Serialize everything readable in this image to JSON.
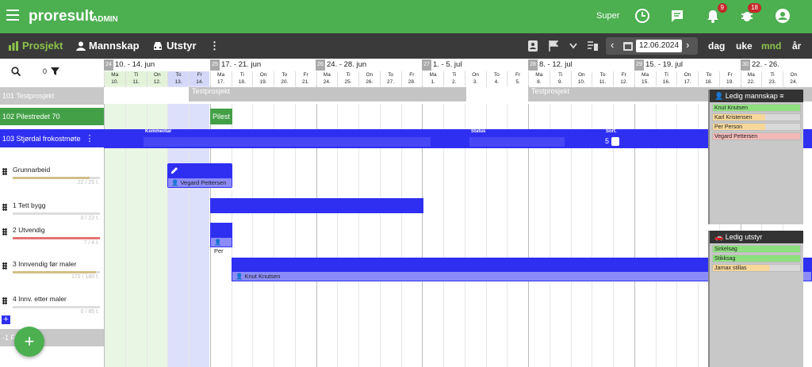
{
  "app": {
    "brand": "proresult",
    "edition": "ADMIN",
    "user": "Super"
  },
  "badges": {
    "notifications": "9",
    "alerts": "18"
  },
  "toolbar": {
    "tab_project": "Prosjekt",
    "tab_manpower": "Mannskap",
    "tab_equipment": "Utstyr",
    "date": "12.06.2024",
    "views": [
      "dag",
      "uke",
      "mnd",
      "år"
    ],
    "active_view": "mnd"
  },
  "filter": {
    "count": "0"
  },
  "weeks": [
    {
      "num": "24",
      "label": "10. - 14. jun"
    },
    {
      "num": "25",
      "label": "17. - 21. jun"
    },
    {
      "num": "26",
      "label": "24. - 28. jun"
    },
    {
      "num": "27",
      "label": "1. - 5. jul"
    },
    {
      "num": "28",
      "label": "8. - 12. jul"
    },
    {
      "num": "29",
      "label": "15. - 19. jul"
    },
    {
      "num": "30",
      "label": "22. - 26."
    }
  ],
  "days": [
    {
      "d": "Ma",
      "n": "10."
    },
    {
      "d": "Ti",
      "n": "11."
    },
    {
      "d": "On",
      "n": "12."
    },
    {
      "d": "To",
      "n": "13."
    },
    {
      "d": "Fr",
      "n": "14."
    },
    {
      "d": "Ma",
      "n": "17."
    },
    {
      "d": "Ti",
      "n": "18."
    },
    {
      "d": "On",
      "n": "19."
    },
    {
      "d": "To",
      "n": "20."
    },
    {
      "d": "Fr",
      "n": "21."
    },
    {
      "d": "Ma",
      "n": "24."
    },
    {
      "d": "Ti",
      "n": "25."
    },
    {
      "d": "On",
      "n": "26."
    },
    {
      "d": "To",
      "n": "27."
    },
    {
      "d": "Fr",
      "n": "28."
    },
    {
      "d": "Ma",
      "n": "1."
    },
    {
      "d": "Ti",
      "n": "2."
    },
    {
      "d": "On",
      "n": "3."
    },
    {
      "d": "To",
      "n": "4."
    },
    {
      "d": "Fr",
      "n": "5."
    },
    {
      "d": "Ma",
      "n": "8."
    },
    {
      "d": "Ti",
      "n": "9."
    },
    {
      "d": "On",
      "n": "10."
    },
    {
      "d": "To",
      "n": "11."
    },
    {
      "d": "Fr",
      "n": "12."
    },
    {
      "d": "Ma",
      "n": "15."
    },
    {
      "d": "Ti",
      "n": "16."
    },
    {
      "d": "On",
      "n": "17."
    },
    {
      "d": "To",
      "n": "18."
    },
    {
      "d": "Fr",
      "n": "19."
    },
    {
      "d": "Ma",
      "n": "22."
    },
    {
      "d": "Ti",
      "n": "23."
    },
    {
      "d": "On",
      "n": "24."
    }
  ],
  "projects": {
    "p101": "101 Testprosjekt",
    "p102": "102 Pilestredet 70",
    "p103": "103 Stjørdal frokostmøte",
    "p_last": "-1 F"
  },
  "tasks": [
    {
      "name": "Grunnarbeid",
      "hours": "22 / 25 t.",
      "progress": 0.88,
      "color": "#cfc08a"
    },
    {
      "name": "1 Tett bygg",
      "hours": "0 / 22 t.",
      "progress": 0,
      "color": "#cfc08a"
    },
    {
      "name": "2 Utvendig",
      "hours": "7 / 4 t.",
      "progress": 1,
      "color": "#e57373"
    },
    {
      "name": "3 Innvendig før maler",
      "hours": "172 / 180 t.",
      "progress": 0.95,
      "color": "#cfc08a"
    },
    {
      "name": "4 Innv. etter maler",
      "hours": "0 / 85 t.",
      "progress": 0,
      "color": "#cfc08a"
    }
  ],
  "bars": {
    "testprosjekt_a": "Testprosjekt",
    "testprosjekt_b": "Testprosjekt",
    "pilest": "Pilest",
    "comment_label": "Kommentar",
    "status_label": "Status",
    "sort_label": "Sort.",
    "sort_value": "5",
    "grunnarbeid_person": "Vegard Pettersen",
    "utvendig_person": "Per",
    "innvendig_person": "Knut Knutsen"
  },
  "panel_people": {
    "title": "Ledig mannskap",
    "items": [
      {
        "name": "Knut Knutsen",
        "fill": 1.0,
        "color": "#8ee07e"
      },
      {
        "name": "Karl Kristensen",
        "fill": 0.6,
        "color": "#f7d79a"
      },
      {
        "name": "Per Person",
        "fill": 0.6,
        "color": "#f7d79a"
      },
      {
        "name": "Vegard Pettersen",
        "fill": 1.0,
        "color": "#f2b8b8"
      }
    ]
  },
  "panel_equipment": {
    "title": "Ledig utstyr",
    "items": [
      {
        "name": "Sirkelsag",
        "fill": 1.0,
        "color": "#8ee07e"
      },
      {
        "name": "Stikksag",
        "fill": 1.0,
        "color": "#8ee07e"
      },
      {
        "name": "Jarnax stillas",
        "fill": 0.65,
        "color": "#f7d79a"
      }
    ]
  }
}
